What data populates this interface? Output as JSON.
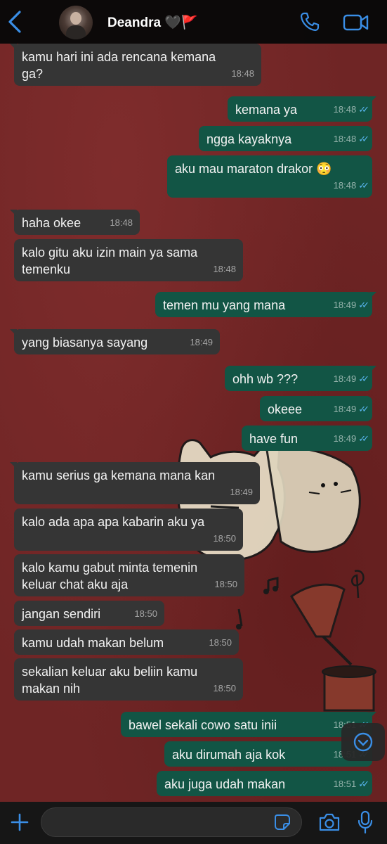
{
  "header": {
    "contact_name": "Deandra 🖤🚩",
    "icons": [
      "back-chevron",
      "avatar-photo",
      "phone-call",
      "video-call"
    ]
  },
  "messages": [
    {
      "dir": "in",
      "text": "kamu hari ini ada rencana kemana\nga?",
      "time": "18:48"
    },
    {
      "dir": "out",
      "text": "kemana ya",
      "time": "18:48",
      "read": true
    },
    {
      "dir": "out",
      "text": "ngga kayaknya",
      "time": "18:48",
      "read": true
    },
    {
      "dir": "out",
      "text": "aku mau maraton drakor 😳",
      "time": "18:48",
      "read": true
    },
    {
      "dir": "in",
      "text": "haha okee",
      "time": "18:48"
    },
    {
      "dir": "in",
      "text": "kalo gitu aku izin main ya sama\ntemenku",
      "time": "18:48"
    },
    {
      "dir": "out",
      "text": "temen mu yang mana",
      "time": "18:49",
      "read": true
    },
    {
      "dir": "in",
      "text": "yang biasanya sayang",
      "time": "18:49"
    },
    {
      "dir": "out",
      "text": "ohh wb ???",
      "time": "18:49",
      "read": true
    },
    {
      "dir": "out",
      "text": "okeee",
      "time": "18:49",
      "read": true
    },
    {
      "dir": "out",
      "text": "have fun",
      "time": "18:49",
      "read": true
    },
    {
      "dir": "in",
      "text": "kamu serius ga kemana mana kan",
      "time": "18:49"
    },
    {
      "dir": "in",
      "text": "kalo ada apa apa kabarin aku ya",
      "time": "18:50"
    },
    {
      "dir": "in",
      "text": "kalo kamu gabut minta temenin\nkeluar chat aku aja",
      "time": "18:50"
    },
    {
      "dir": "in",
      "text": "jangan sendiri",
      "time": "18:50"
    },
    {
      "dir": "in",
      "text": "kamu udah makan belum",
      "time": "18:50"
    },
    {
      "dir": "in",
      "text": "sekalian keluar aku beliin kamu\nmakan nih",
      "time": "18:50"
    },
    {
      "dir": "out",
      "text": "bawel sekali cowo satu inii",
      "time": "18:51",
      "read": true
    },
    {
      "dir": "out",
      "text": "aku dirumah aja kok",
      "time": "18:51",
      "read": true
    },
    {
      "dir": "out",
      "text": "aku juga udah makan",
      "time": "18:51",
      "read": true
    }
  ],
  "input": {
    "placeholder": ""
  },
  "colors": {
    "incoming": "#353535",
    "outgoing": "#125545",
    "accent": "#3a8ee6",
    "read_tick": "#58b6f0"
  }
}
